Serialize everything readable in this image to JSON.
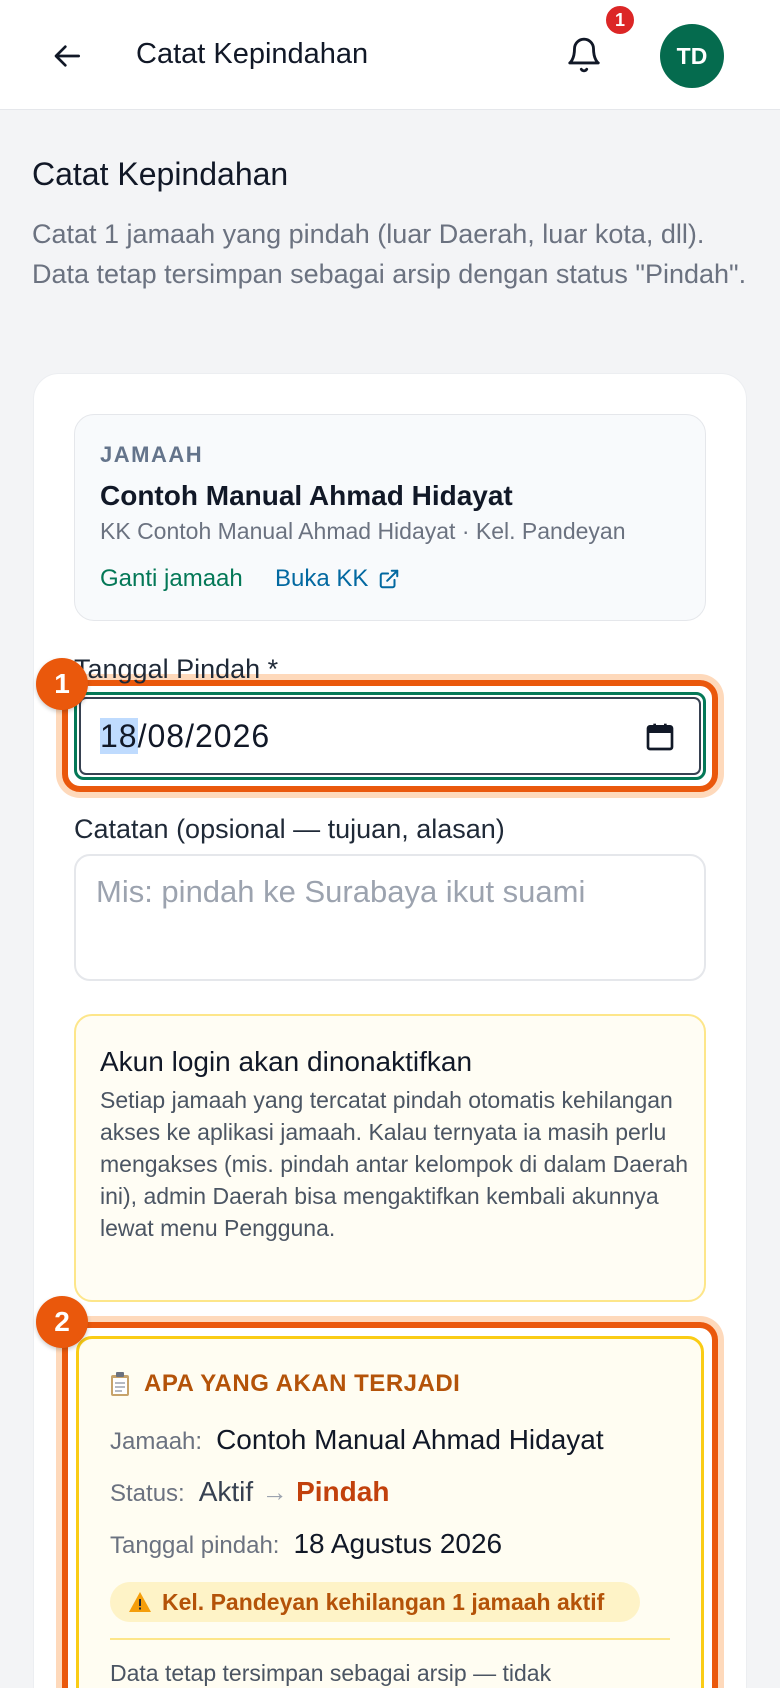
{
  "header": {
    "title": "Catat Kepindahan",
    "notification_count": "1",
    "avatar_initials": "TD"
  },
  "page": {
    "title": "Catat Kepindahan",
    "description": "Catat 1 jamaah yang pindah (luar Daerah, luar kota, dll). Data tetap tersimpan sebagai arsip dengan status \"Pindah\"."
  },
  "jamaah": {
    "label": "JAMAAH",
    "name": "Contoh Manual Ahmad Hidayat",
    "subtitle": "KK Contoh Manual Ahmad Hidayat · Kel. Pandeyan",
    "change_link": "Ganti jamaah",
    "open_kk_link": "Buka KK"
  },
  "date_field": {
    "label": "Tanggal Pindah *",
    "day": "18",
    "rest": "/08/2026"
  },
  "note_field": {
    "label": "Catatan (opsional — tujuan, alasan)",
    "placeholder": "Mis: pindah ke Surabaya ikut suami",
    "value": ""
  },
  "warning": {
    "title": "Akun login akan dinonaktifkan",
    "body": "Setiap jamaah yang tercatat pindah otomatis kehilangan akses ke aplikasi jamaah. Kalau ternyata ia masih perlu mengakses (mis. pindah antar kelompok di dalam Daerah ini), admin Daerah bisa mengaktifkan kembali akunnya lewat menu Pengguna."
  },
  "preview": {
    "title": "APA YANG AKAN TERJADI",
    "jamaah_label": "Jamaah:",
    "jamaah_value": "Contoh Manual Ahmad Hidayat",
    "status_label": "Status:",
    "status_from": "Aktif",
    "status_arrow": "→",
    "status_to": "Pindah",
    "date_label": "Tanggal pindah:",
    "date_value": "18 Agustus 2026",
    "impact": "Kel. Pandeyan kehilangan 1 jamaah aktif",
    "footer": "Data tetap tersimpan sebagai arsip — tidak"
  },
  "markers": [
    "1",
    "2"
  ],
  "icons": {
    "back": "arrow-left-icon",
    "bell": "bell-icon",
    "external": "external-link-icon",
    "calendar": "calendar-icon",
    "clipboard": "clipboard-icon",
    "warning": "warning-icon"
  },
  "colors": {
    "primary_green": "#047857",
    "link_blue": "#0369a1",
    "highlight_orange": "#ea580c",
    "warn_amber": "#b45309",
    "badge_red": "#dc2626"
  }
}
